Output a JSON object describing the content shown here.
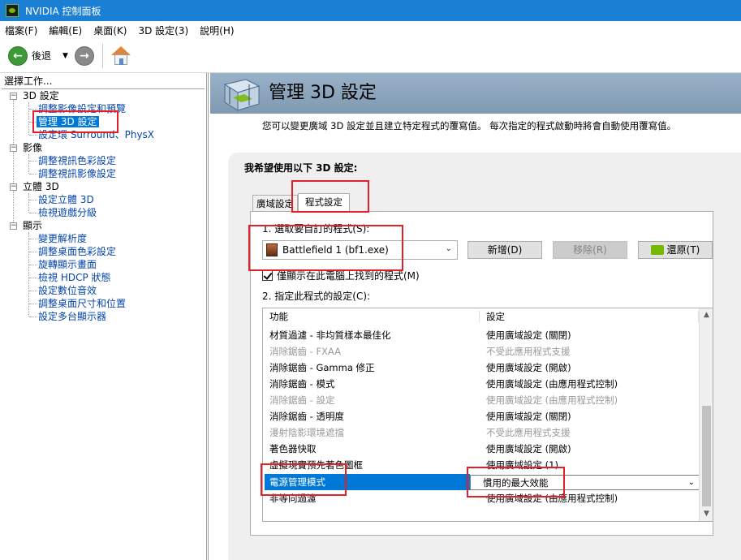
{
  "window": {
    "title": "NVIDIA 控制面板"
  },
  "menu": [
    "檔案(F)",
    "編輯(E)",
    "桌面(K)",
    "3D 設定(3)",
    "說明(H)"
  ],
  "toolbar": {
    "back_label": "後退"
  },
  "left_pane": {
    "title": "選擇工作...",
    "tree": [
      {
        "label": "3D 設定",
        "children": [
          "調整影像設定和預覽",
          "管理 3D 設定",
          "設定環 Surround、PhysX"
        ]
      },
      {
        "label": "影像",
        "children": [
          "調整視訊色彩設定",
          "調整視訊影像設定"
        ]
      },
      {
        "label": "立體 3D",
        "children": [
          "設定立體 3D",
          "檢視遊戲分級"
        ]
      },
      {
        "label": "顯示",
        "children": [
          "變更解析度",
          "調整桌面色彩設定",
          "旋轉顯示畫面",
          "檢視 HDCP 狀態",
          "設定數位音效",
          "調整桌面尺寸和位置",
          "設定多台顯示器"
        ]
      }
    ]
  },
  "main": {
    "title": "管理 3D 設定",
    "intro": "您可以變更廣域 3D 設定並且建立特定程式的覆寫值。 每次指定的程式啟動時將會自動使用覆寫值。",
    "panel_title": "我希望使用以下 3D 設定:",
    "tabs": [
      "廣域設定",
      "程式設定"
    ],
    "step1": "1. 選取要自訂的程式(S):",
    "program": "Battlefield 1 (bf1.exe)",
    "buttons": {
      "add": "新增(D)",
      "remove": "移除(R)",
      "restore": "還原(T)"
    },
    "checkbox_label": "僅顯示在此電腦上找到的程式(M)",
    "step2": "2. 指定此程式的設定(C):",
    "list_headers": {
      "feature": "功能",
      "setting": "設定"
    },
    "rows": [
      {
        "feature": "材質過濾 - 非均質樣本最佳化",
        "setting": "使用廣域設定 (關閉)"
      },
      {
        "feature": "消除鋸齒 - FXAA",
        "setting": "不受此應用程式支援"
      },
      {
        "feature": "消除鋸齒 - Gamma 修正",
        "setting": "使用廣域設定 (開啟)"
      },
      {
        "feature": "消除鋸齒 - 模式",
        "setting": "使用廣域設定 (由應用程式控制)"
      },
      {
        "feature": "消除鋸齒 - 設定",
        "setting": "使用廣域設定 (由應用程式控制)"
      },
      {
        "feature": "消除鋸齒 - 透明度",
        "setting": "使用廣域設定 (關閉)"
      },
      {
        "feature": "漫射陰影環境遮擋",
        "setting": "不受此應用程式支援"
      },
      {
        "feature": "著色器快取",
        "setting": "使用廣域設定 (開啟)"
      },
      {
        "feature": "虛擬現實預先著色圖框",
        "setting": "使用廣域設定 (1)"
      },
      {
        "feature": "電源管理模式",
        "setting": "慣用的最大效能"
      },
      {
        "feature": "非等向過濾",
        "setting": "使用廣域設定 (由應用程式控制)"
      }
    ]
  }
}
